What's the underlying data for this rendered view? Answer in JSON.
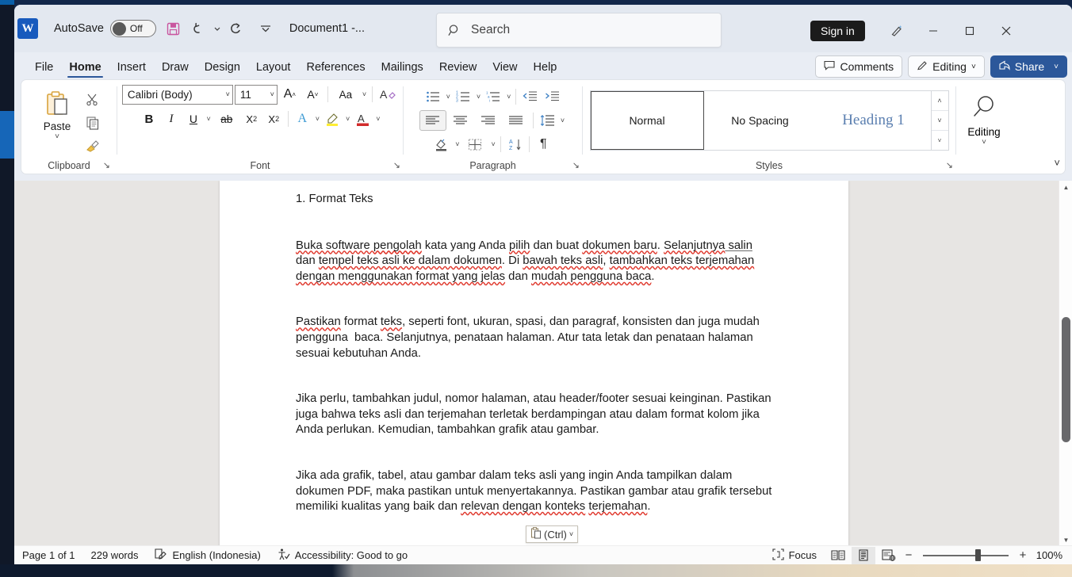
{
  "titlebar": {
    "app_logo": "word-logo",
    "autosave_label": "AutoSave",
    "autosave_state": "Off",
    "doc_title": "Document1  -...",
    "save_icon": "save-icon",
    "undo_icon": "undo-icon",
    "redo_icon": "redo-icon",
    "customize_icon": "customize-quick-access-icon",
    "sign_in": "Sign in",
    "minimize": "minimize-icon",
    "maximize": "maximize-icon",
    "close": "close-icon"
  },
  "search": {
    "placeholder": "Search",
    "icon": "search-icon"
  },
  "tabs": [
    {
      "label": "File",
      "active": false
    },
    {
      "label": "Home",
      "active": true
    },
    {
      "label": "Insert",
      "active": false
    },
    {
      "label": "Draw",
      "active": false
    },
    {
      "label": "Design",
      "active": false
    },
    {
      "label": "Layout",
      "active": false
    },
    {
      "label": "References",
      "active": false
    },
    {
      "label": "Mailings",
      "active": false
    },
    {
      "label": "Review",
      "active": false
    },
    {
      "label": "View",
      "active": false
    },
    {
      "label": "Help",
      "active": false
    }
  ],
  "tabs_right": {
    "comments": "Comments",
    "editing": "Editing",
    "editing_caret": "˅",
    "share": "Share",
    "share_caret": "˅"
  },
  "ribbon": {
    "clipboard": {
      "group_label": "Clipboard",
      "paste_label": "Paste",
      "paste_caret": "˅",
      "cut_icon": "cut-scissors-icon",
      "copy_icon": "copy-icon",
      "format_painter_icon": "format-painter-icon",
      "dialog_launcher": "↘"
    },
    "font": {
      "group_label": "Font",
      "font_name": "Calibri (Body)",
      "font_size": "11",
      "grow_font": "A",
      "shrink_font": "A",
      "change_case": "Aa",
      "clear_formatting": "A",
      "bold": "B",
      "italic": "I",
      "underline": "U",
      "strikethrough": "ab",
      "subscript": "X",
      "superscript": "X",
      "text_effects": "A",
      "highlight": "highlight-icon",
      "font_color": "font-color-icon",
      "dialog_launcher": "↘"
    },
    "paragraph": {
      "group_label": "Paragraph",
      "bullets_icon": "bullet-list-icon",
      "numbering_icon": "numbered-list-icon",
      "multilevel_icon": "multilevel-list-icon",
      "decrease_indent_icon": "decrease-indent-icon",
      "increase_indent_icon": "increase-indent-icon",
      "align_left_icon": "align-left-icon",
      "align_center_icon": "align-center-icon",
      "align_right_icon": "align-right-icon",
      "justify_icon": "justify-icon",
      "line_spacing_icon": "line-spacing-icon",
      "shading_icon": "shading-icon",
      "borders_icon": "borders-icon",
      "sort_icon": "sort-az-icon",
      "show_marks_icon": "pilcrow-icon",
      "dialog_launcher": "↘"
    },
    "styles": {
      "group_label": "Styles",
      "items": [
        {
          "label": "Normal",
          "selected": true
        },
        {
          "label": "No Spacing",
          "selected": false
        },
        {
          "label": "Heading 1",
          "selected": false
        }
      ],
      "scroll_up": "˄",
      "scroll_down": "˅",
      "more": "˅",
      "dialog_launcher": "↘"
    },
    "editing": {
      "label": "Editing",
      "icon": "magnifier-icon",
      "caret": "˅"
    },
    "collapse_caret": "˅"
  },
  "document": {
    "heading": "1. Format Teks",
    "paragraphs": [
      {
        "runs": [
          {
            "t": "Buka software ",
            "s": ""
          },
          {
            "t": "pengolah",
            "s": "sq"
          },
          {
            "t": " kata yang Anda ",
            "s": ""
          },
          {
            "t": "pilih",
            "s": "sq"
          },
          {
            "t": " dan buat ",
            "s": ""
          },
          {
            "t": "dokumen baru",
            "s": "sq"
          },
          {
            "t": ". ",
            "s": ""
          },
          {
            "t": "Selanjutnya",
            "s": "sq"
          },
          {
            "t": " salin",
            "s": "sqb"
          },
          {
            "t": " dan ",
            "s": ""
          },
          {
            "t": "tempel teks asli ke dalam dokumen",
            "s": "sq"
          },
          {
            "t": ". Di ",
            "s": ""
          },
          {
            "t": "bawah teks asli",
            "s": "sq"
          },
          {
            "t": ", ",
            "s": ""
          },
          {
            "t": "tambahkan teks terjemahan dengan menggunakan format yang jelas",
            "s": "sq"
          },
          {
            "t": " dan ",
            "s": ""
          },
          {
            "t": "mudah pengguna baca",
            "s": "sq"
          },
          {
            "t": ".",
            "s": ""
          }
        ]
      },
      {
        "runs": [
          {
            "t": "Pastikan",
            "s": "sq"
          },
          {
            "t": " format ",
            "s": ""
          },
          {
            "t": "teks",
            "s": "sq"
          },
          {
            "t": ", seperti font, ukuran, spasi, dan paragraf, konsisten dan juga mudah pengguna  baca. Selanjutnya, penataan halaman. Atur tata letak dan penataan halaman sesuai kebutuhan Anda.",
            "s": ""
          }
        ]
      },
      {
        "runs": [
          {
            "t": "Jika perlu, tambahkan judul, nomor halaman, atau header/footer sesuai keinginan. Pastikan juga bahwa teks asli dan terjemahan terletak berdampingan atau dalam format kolom jika Anda perlukan. Kemudian, tambahkan grafik atau gambar.",
            "s": ""
          }
        ]
      },
      {
        "runs": [
          {
            "t": "Jika ada grafik, tabel, atau gambar dalam teks asli yang ingin Anda tampilkan dalam dokumen PDF, maka pastikan untuk menyertakannya. Pastikan gambar atau grafik tersebut memiliki kualitas yang baik dan ",
            "s": ""
          },
          {
            "t": "relevan dengan konteks",
            "s": "sq"
          },
          {
            "t": " ",
            "s": ""
          },
          {
            "t": "terjemahan",
            "s": "sq"
          },
          {
            "t": ".",
            "s": ""
          }
        ]
      }
    ],
    "paste_options": {
      "icon": "paste-options-icon",
      "label": "(Ctrl)",
      "caret": "˅"
    }
  },
  "statusbar": {
    "page": "Page 1 of 1",
    "words": "229 words",
    "proofing_icon": "proofing-icon",
    "language": "English (Indonesia)",
    "accessibility_icon": "accessibility-icon",
    "accessibility": "Accessibility: Good to go",
    "focus_icon": "focus-icon",
    "focus": "Focus",
    "read_mode_icon": "read-mode-icon",
    "print_layout_icon": "print-layout-icon",
    "web_layout_icon": "web-layout-icon",
    "zoom_out": "−",
    "zoom_in": "+",
    "zoom_level": "100%"
  },
  "colors": {
    "accent": "#2b579a",
    "titlebar_bg": "#e3e8f0",
    "ribbon_bg": "#ffffff",
    "page_bg": "#ffffff",
    "doc_area_bg": "#e7e5e3",
    "spell_error": "#e03a2f"
  }
}
